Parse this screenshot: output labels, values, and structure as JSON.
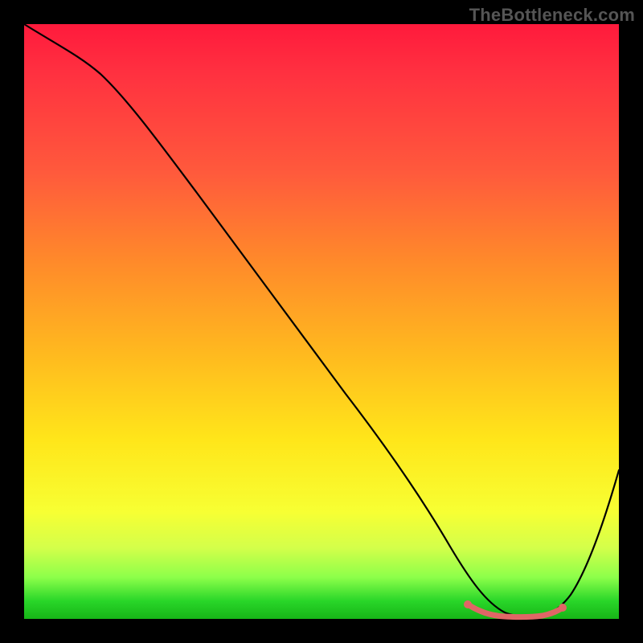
{
  "watermark": "TheBottleneck.com",
  "colors": {
    "background": "#000000",
    "gradient_top": "#ff1a3c",
    "gradient_bottom": "#17b517",
    "curve": "#000000",
    "min_highlight": "#e06666"
  },
  "chart_data": {
    "type": "line",
    "title": "",
    "xlabel": "",
    "ylabel": "",
    "xlim": [
      0,
      100
    ],
    "ylim": [
      0,
      100
    ],
    "x": [
      0,
      3,
      7,
      12,
      20,
      30,
      40,
      50,
      60,
      66,
      70,
      74,
      78,
      82,
      86,
      90,
      95,
      100
    ],
    "values": [
      100,
      98,
      96,
      93,
      85,
      73,
      60,
      48,
      35,
      26,
      18,
      10,
      3,
      0,
      0,
      2,
      12,
      28
    ],
    "annotations": {
      "minimum_range_x": [
        74,
        88
      ],
      "minimum_value": 0
    }
  }
}
